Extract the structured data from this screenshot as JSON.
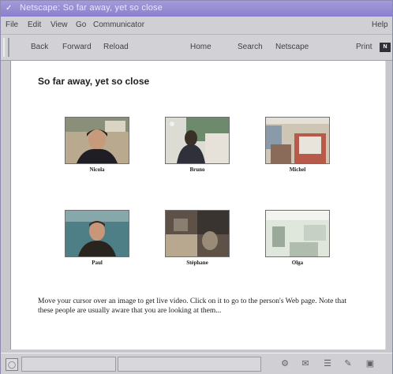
{
  "window": {
    "title": "Netscape: So far away, yet so close"
  },
  "menu": {
    "items": [
      "File",
      "Edit",
      "View",
      "Go",
      "Communicator"
    ],
    "help": "Help"
  },
  "toolbar": {
    "back": "Back",
    "forward": "Forward",
    "reload": "Reload",
    "home": "Home",
    "search": "Search",
    "netscape": "Netscape",
    "print": "Print"
  },
  "page": {
    "heading": "So far away, yet so close",
    "people": [
      {
        "name": "Nicola",
        "colors": {
          "bg": "#b9a98e",
          "fg": "#1e1e24"
        }
      },
      {
        "name": "Bruno",
        "colors": {
          "bg": "#6e8a6c",
          "fg": "#30303a"
        }
      },
      {
        "name": "Michel",
        "colors": {
          "bg": "#cfc5b4",
          "fg": "#8a6a58"
        }
      },
      {
        "name": "Paul",
        "colors": {
          "bg": "#4f7f86",
          "fg": "#2a241e"
        }
      },
      {
        "name": "Stéphane",
        "colors": {
          "bg": "#5e5248",
          "fg": "#b8a890"
        }
      },
      {
        "name": "Olga",
        "colors": {
          "bg": "#dfe6dc",
          "fg": "#9aa99a"
        }
      }
    ],
    "instructions": "Move your cursor over an image to get live video. Click on it to go to the person's Web page. Note that these people are usually aware that you are looking at them..."
  }
}
